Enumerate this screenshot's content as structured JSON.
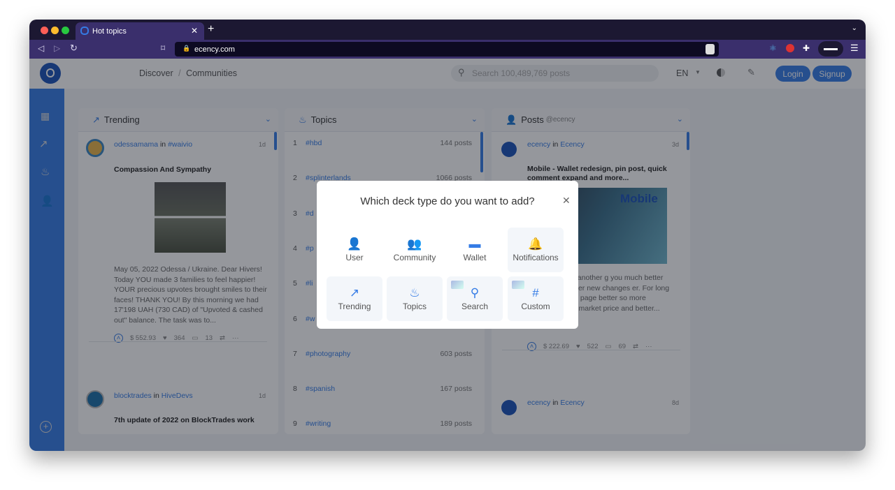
{
  "browser": {
    "tab_title": "Hot topics",
    "url": "ecency.com"
  },
  "header": {
    "breadcrumb": [
      "Discover",
      "Communities"
    ],
    "breadcrumb_sep": "/",
    "search_placeholder": "Search 100,489,769 posts",
    "language": "EN",
    "login": "Login",
    "signup": "Signup"
  },
  "columns": {
    "trending": {
      "title": "Trending",
      "posts": [
        {
          "author": "odessamama",
          "in": "in",
          "community": "#waivio",
          "age": "1d",
          "title": "Compassion And Sympathy",
          "body": "May 05, 2022 Odessa / Ukraine. Dear Hivers! Today YOU made 3 families to feel happier! YOUR precious upvotes brought smiles to their faces! THANK YOU! By this morning we had 17'198 UAH (730 CAD) of \"Upvoted & cashed out\" balance. The task was to...",
          "payout": "$ 552.93",
          "votes": "364",
          "comments": "13"
        },
        {
          "author": "blocktrades",
          "in": "in",
          "community": "HiveDevs",
          "age": "1d",
          "title": "7th update of 2022 on BlockTrades work"
        }
      ]
    },
    "topics": {
      "title": "Topics",
      "items": [
        {
          "rank": "1",
          "tag": "#hbd",
          "count": "144 posts"
        },
        {
          "rank": "2",
          "tag": "#splinterlands",
          "count": "1066 posts"
        },
        {
          "rank": "3",
          "tag": "#d",
          "count": ""
        },
        {
          "rank": "4",
          "tag": "#p",
          "count": ""
        },
        {
          "rank": "5",
          "tag": "#li",
          "count": ""
        },
        {
          "rank": "6",
          "tag": "#w",
          "count": ""
        },
        {
          "rank": "7",
          "tag": "#photography",
          "count": "603 posts"
        },
        {
          "rank": "8",
          "tag": "#spanish",
          "count": "167 posts"
        },
        {
          "rank": "9",
          "tag": "#writing",
          "count": "189 posts"
        }
      ]
    },
    "posts": {
      "title": "Posts",
      "user": "@ecency",
      "posts": [
        {
          "author": "ecency",
          "in": "in",
          "community": "Ecency",
          "age": "3d",
          "title": "Mobile - Wallet redesign, pin post, quick comment expand and more...",
          "image_text": "Mobile",
          "body": "mobile app got another g you much better wallet many other new changes er. For long time we wanted page better so more information like market price and better...",
          "payout": "$ 222.69",
          "votes": "522",
          "comments": "69"
        },
        {
          "author": "ecency",
          "in": "in",
          "community": "Ecency",
          "age": "8d"
        }
      ]
    }
  },
  "modal": {
    "title": "Which deck type do you want to add?",
    "options": [
      {
        "label": "User",
        "icon": "user-icon"
      },
      {
        "label": "Community",
        "icon": "community-icon"
      },
      {
        "label": "Wallet",
        "icon": "wallet-icon"
      },
      {
        "label": "Notifications",
        "icon": "bell-icon"
      },
      {
        "label": "Trending",
        "icon": "trending-icon"
      },
      {
        "label": "Topics",
        "icon": "fire-icon"
      },
      {
        "label": "Search",
        "icon": "search-icon"
      },
      {
        "label": "Custom",
        "icon": "hash-icon"
      }
    ]
  },
  "colors": {
    "accent": "#357ce6",
    "browser_toolbar": "#3a2f6c",
    "titlebar": "#1c1832"
  }
}
